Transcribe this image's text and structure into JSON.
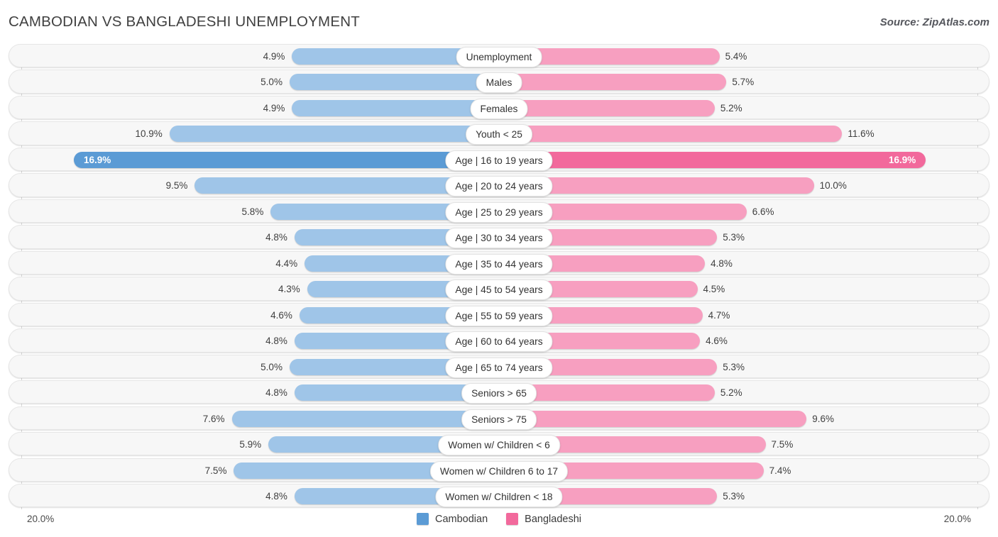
{
  "header": {
    "title": "CAMBODIAN VS BANGLADESHI UNEMPLOYMENT",
    "source": "Source: ZipAtlas.com"
  },
  "axis": {
    "left_label": "20.0%",
    "right_label": "20.0%",
    "max": 20.0
  },
  "legend": {
    "items": [
      {
        "label": "Cambodian",
        "color": "#5b9bd5"
      },
      {
        "label": "Bangladeshi",
        "color": "#f2699c"
      }
    ]
  },
  "colors": {
    "left_bar": "#9fc5e8",
    "right_bar": "#f79fc0",
    "left_bar_highlight": "#5b9bd5",
    "right_bar_highlight": "#f2699c",
    "row_track": "#f7f7f7",
    "gridline": "#d8d8d8"
  },
  "chart_data": {
    "type": "bar",
    "title": "CAMBODIAN VS BANGLADESHI UNEMPLOYMENT",
    "subtitle": "",
    "xlabel": "",
    "ylabel": "",
    "orientation": "horizontal-diverging",
    "grid": false,
    "legend_position": "bottom-center",
    "xlim": [
      20.0,
      20.0
    ],
    "unit": "%",
    "categories": [
      "Unemployment",
      "Males",
      "Females",
      "Youth < 25",
      "Age | 16 to 19 years",
      "Age | 20 to 24 years",
      "Age | 25 to 29 years",
      "Age | 30 to 34 years",
      "Age | 35 to 44 years",
      "Age | 45 to 54 years",
      "Age | 55 to 59 years",
      "Age | 60 to 64 years",
      "Age | 65 to 74 years",
      "Seniors > 65",
      "Seniors > 75",
      "Women w/ Children < 6",
      "Women w/ Children 6 to 17",
      "Women w/ Children < 18"
    ],
    "series": [
      {
        "name": "Cambodian",
        "values": [
          4.9,
          5.0,
          4.9,
          10.9,
          16.9,
          9.5,
          5.8,
          4.8,
          4.4,
          4.3,
          4.6,
          4.8,
          5.0,
          4.8,
          7.6,
          5.9,
          7.5,
          4.8
        ]
      },
      {
        "name": "Bangladeshi",
        "values": [
          5.4,
          5.7,
          5.2,
          11.6,
          16.9,
          10.0,
          6.6,
          5.3,
          4.8,
          4.5,
          4.7,
          4.6,
          5.3,
          5.2,
          9.6,
          7.5,
          7.4,
          5.3
        ]
      }
    ],
    "highlight_row": 4
  },
  "rows": [
    {
      "label": "Unemployment",
      "left": "4.9%",
      "right": "5.4%",
      "lv": 4.9,
      "rv": 5.4,
      "hl": false
    },
    {
      "label": "Males",
      "left": "5.0%",
      "right": "5.7%",
      "lv": 5.0,
      "rv": 5.7,
      "hl": false
    },
    {
      "label": "Females",
      "left": "4.9%",
      "right": "5.2%",
      "lv": 4.9,
      "rv": 5.2,
      "hl": false
    },
    {
      "label": "Youth < 25",
      "left": "10.9%",
      "right": "11.6%",
      "lv": 10.9,
      "rv": 11.6,
      "hl": false
    },
    {
      "label": "Age | 16 to 19 years",
      "left": "16.9%",
      "right": "16.9%",
      "lv": 16.9,
      "rv": 16.9,
      "hl": true
    },
    {
      "label": "Age | 20 to 24 years",
      "left": "9.5%",
      "right": "10.0%",
      "lv": 9.5,
      "rv": 10.0,
      "hl": false
    },
    {
      "label": "Age | 25 to 29 years",
      "left": "5.8%",
      "right": "6.6%",
      "lv": 5.8,
      "rv": 6.6,
      "hl": false
    },
    {
      "label": "Age | 30 to 34 years",
      "left": "4.8%",
      "right": "5.3%",
      "lv": 4.8,
      "rv": 5.3,
      "hl": false
    },
    {
      "label": "Age | 35 to 44 years",
      "left": "4.4%",
      "right": "4.8%",
      "lv": 4.4,
      "rv": 4.8,
      "hl": false
    },
    {
      "label": "Age | 45 to 54 years",
      "left": "4.3%",
      "right": "4.5%",
      "lv": 4.3,
      "rv": 4.5,
      "hl": false
    },
    {
      "label": "Age | 55 to 59 years",
      "left": "4.6%",
      "right": "4.7%",
      "lv": 4.6,
      "rv": 4.7,
      "hl": false
    },
    {
      "label": "Age | 60 to 64 years",
      "left": "4.8%",
      "right": "4.6%",
      "lv": 4.8,
      "rv": 4.6,
      "hl": false
    },
    {
      "label": "Age | 65 to 74 years",
      "left": "5.0%",
      "right": "5.3%",
      "lv": 5.0,
      "rv": 5.3,
      "hl": false
    },
    {
      "label": "Seniors > 65",
      "left": "4.8%",
      "right": "5.2%",
      "lv": 4.8,
      "rv": 5.2,
      "hl": false
    },
    {
      "label": "Seniors > 75",
      "left": "7.6%",
      "right": "9.6%",
      "lv": 7.6,
      "rv": 9.6,
      "hl": false
    },
    {
      "label": "Women w/ Children < 6",
      "left": "5.9%",
      "right": "7.5%",
      "lv": 5.9,
      "rv": 7.5,
      "hl": false
    },
    {
      "label": "Women w/ Children 6 to 17",
      "left": "7.5%",
      "right": "7.4%",
      "lv": 7.5,
      "rv": 7.4,
      "hl": false
    },
    {
      "label": "Women w/ Children < 18",
      "left": "4.8%",
      "right": "5.3%",
      "lv": 4.8,
      "rv": 5.3,
      "hl": false
    }
  ]
}
